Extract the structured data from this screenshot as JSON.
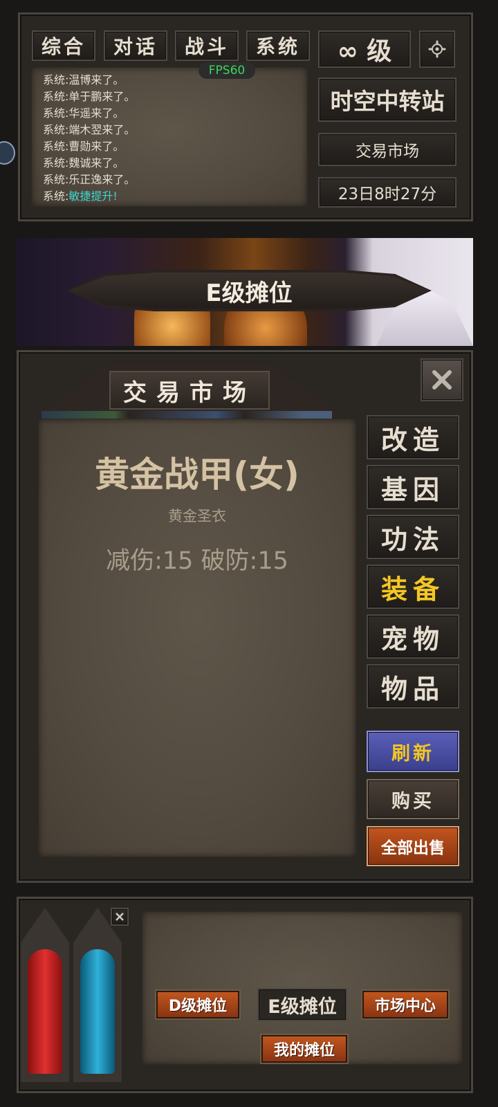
{
  "chat": {
    "tabs": [
      "综合",
      "对话",
      "战斗",
      "系统"
    ],
    "fps": "FPS60",
    "messages": [
      {
        "prefix": "系统:",
        "text": "温博来了。",
        "highlight": false
      },
      {
        "prefix": "系统:",
        "text": "单于鹏来了。",
        "highlight": false
      },
      {
        "prefix": "系统:",
        "text": "华遥来了。",
        "highlight": false
      },
      {
        "prefix": "系统:",
        "text": "端木翌来了。",
        "highlight": false
      },
      {
        "prefix": "系统:",
        "text": "曹勋来了。",
        "highlight": false
      },
      {
        "prefix": "系统:",
        "text": "魏诚来了。",
        "highlight": false
      },
      {
        "prefix": "系统:",
        "text": "乐正逸来了。",
        "highlight": false
      },
      {
        "prefix": "系统:",
        "text": "敏捷提升!",
        "highlight": true
      }
    ]
  },
  "header": {
    "level": "∞ 级",
    "location": "时空中转站",
    "sublocation": "交易市场",
    "time": "23日8时27分"
  },
  "banner": {
    "title": "E级摊位"
  },
  "market": {
    "title": "交易市场",
    "item": {
      "name": "黄金战甲(女)",
      "subtitle": "黄金圣衣",
      "stats": "减伤:15 破防:15"
    },
    "categories": [
      {
        "label": "改造",
        "active": false
      },
      {
        "label": "基因",
        "active": false
      },
      {
        "label": "功法",
        "active": false
      },
      {
        "label": "装备",
        "active": true
      },
      {
        "label": "宠物",
        "active": false
      },
      {
        "label": "物品",
        "active": false
      }
    ],
    "refresh": "刷新",
    "buy": "购买",
    "sell_all": "全部出售"
  },
  "stalls": {
    "d_stall": "D级摊位",
    "e_stall": "E级摊位",
    "market_center": "市场中心",
    "my_stall": "我的摊位"
  },
  "colors": {
    "highlight": "#3fd6cf",
    "active": "#f3c623",
    "fps": "#3cd65a"
  }
}
